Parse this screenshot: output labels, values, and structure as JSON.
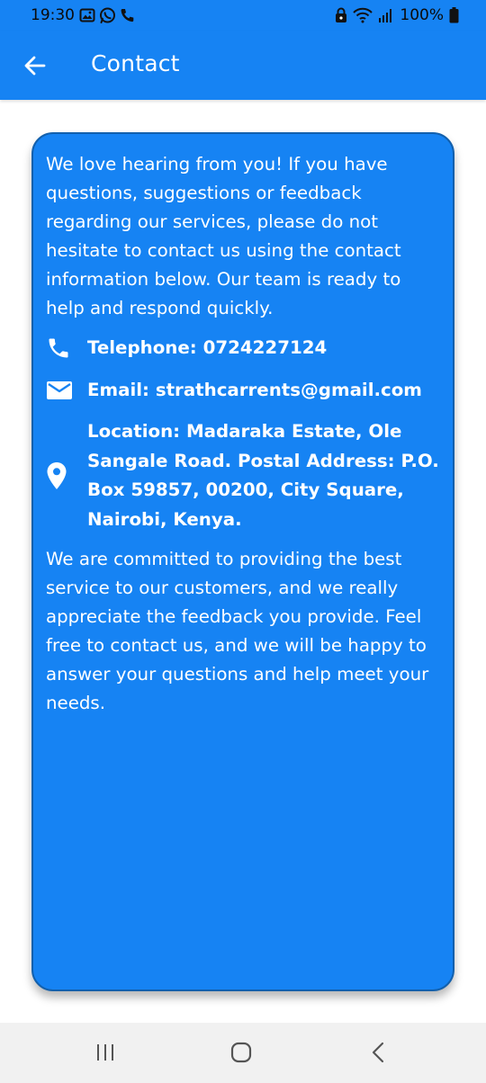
{
  "status_bar": {
    "time": "19:30",
    "battery_text": "100%",
    "icons": [
      "gallery-icon",
      "whatsapp-icon",
      "phone-call-icon",
      "lock-icon",
      "wifi-icon",
      "signal-icon",
      "battery-icon"
    ]
  },
  "app_bar": {
    "title": "Contact",
    "back_icon": "arrow-left-icon"
  },
  "card": {
    "intro": "We love hearing from you! If you have questions, suggestions or feedback regarding our services, please do not hesitate to contact us using the contact information below. Our team is ready to help and respond quickly.",
    "telephone": "Telephone: 0724227124",
    "email": "Email: strathcarrents@gmail.com",
    "location": "Location: Madaraka Estate, Ole Sangale Road. Postal Address: P.O. Box 59857, 00200, City Square, Nairobi, Kenya.",
    "closing": "We are committed to providing the best service to our customers, and we really appreciate the feedback you provide. Feel free to contact us, and we will be happy to answer your questions and help meet your needs."
  },
  "nav_bar": {
    "icons": [
      "recents-icon",
      "home-icon",
      "back-nav-icon"
    ]
  },
  "colors": {
    "primary": "#1683f3",
    "card_border": "#1260ad",
    "nav_bar": "#f1f1f1"
  }
}
